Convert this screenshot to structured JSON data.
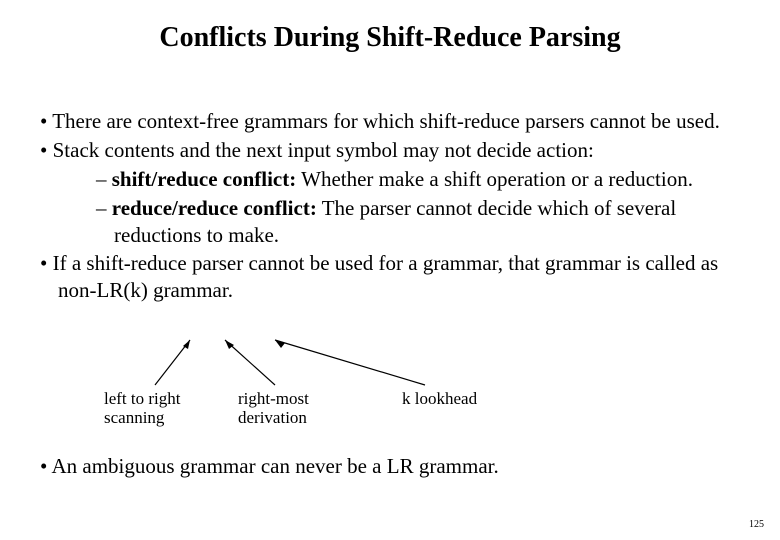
{
  "title": "Conflicts During Shift-Reduce Parsing",
  "bullets": {
    "b1": "There are context-free grammars for which shift-reduce parsers cannot be used.",
    "b2": "Stack contents and the next input symbol may not decide action:",
    "b2a_label": "shift/reduce conflict:",
    "b2a_rest": " Whether make a shift operation or a reduction.",
    "b2b_label": "reduce/reduce conflict:",
    "b2b_rest": " The parser cannot decide which of several reductions to make.",
    "b3": "If a shift-reduce parser cannot be used for a grammar, that grammar is called as non-LR(k) grammar."
  },
  "annotations": {
    "left_line1": "left to right",
    "left_line2": "scanning",
    "mid_line1": "right-most",
    "mid_line2": "derivation",
    "right": "k lookhead"
  },
  "final": "An ambiguous grammar can never be a LR grammar.",
  "pagenum": "125"
}
